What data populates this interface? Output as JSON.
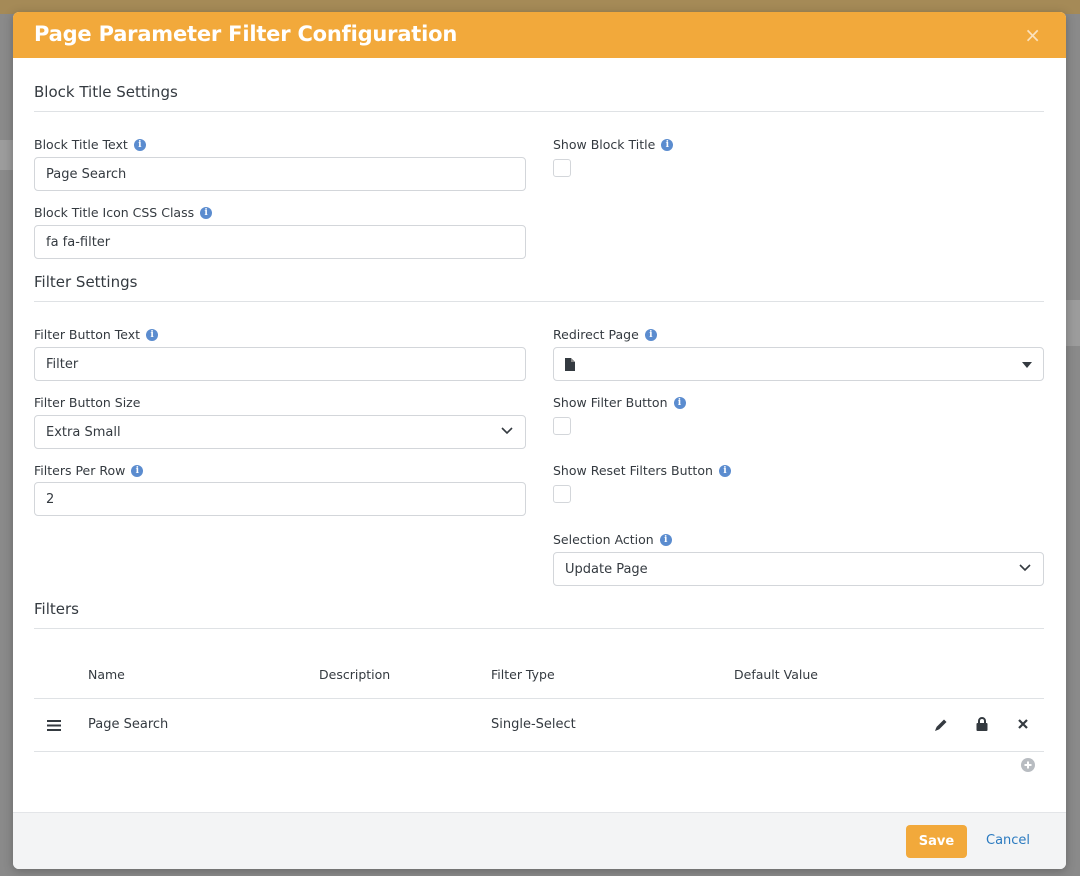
{
  "modal": {
    "title": "Page Parameter Filter Configuration",
    "close_glyph": "×"
  },
  "block_title_settings": {
    "heading": "Block Title Settings",
    "block_title_text": {
      "label": "Block Title Text",
      "value": "Page Search"
    },
    "show_block_title": {
      "label": "Show Block Title",
      "checked": false
    },
    "block_title_icon_css_class": {
      "label": "Block Title Icon CSS Class",
      "value": "fa fa-filter"
    }
  },
  "filter_settings": {
    "heading": "Filter Settings",
    "filter_button_text": {
      "label": "Filter Button Text",
      "value": "Filter"
    },
    "redirect_page": {
      "label": "Redirect Page",
      "value": ""
    },
    "filter_button_size": {
      "label": "Filter Button Size",
      "value": "Extra Small"
    },
    "show_filter_button": {
      "label": "Show Filter Button",
      "checked": false
    },
    "filters_per_row": {
      "label": "Filters Per Row",
      "value": "2"
    },
    "show_reset_filters_button": {
      "label": "Show Reset Filters Button",
      "checked": false
    },
    "selection_action": {
      "label": "Selection Action",
      "value": "Update Page"
    }
  },
  "filters": {
    "heading": "Filters",
    "columns": [
      "Name",
      "Description",
      "Filter Type",
      "Default Value"
    ],
    "rows": [
      {
        "name": "Page Search",
        "description": "",
        "filter_type": "Single-Select",
        "default_value": ""
      }
    ]
  },
  "footer": {
    "save_label": "Save",
    "cancel_label": "Cancel"
  },
  "colors": {
    "accent": "#f2a93b",
    "info_icon": "#5b8ccf",
    "link": "#2a7ac0"
  },
  "icons": [
    "info-icon",
    "file-icon",
    "chevron-down-icon",
    "caret-down-icon",
    "drag-handle-icon",
    "pencil-icon",
    "lock-icon",
    "close-icon",
    "add-circle-icon"
  ]
}
